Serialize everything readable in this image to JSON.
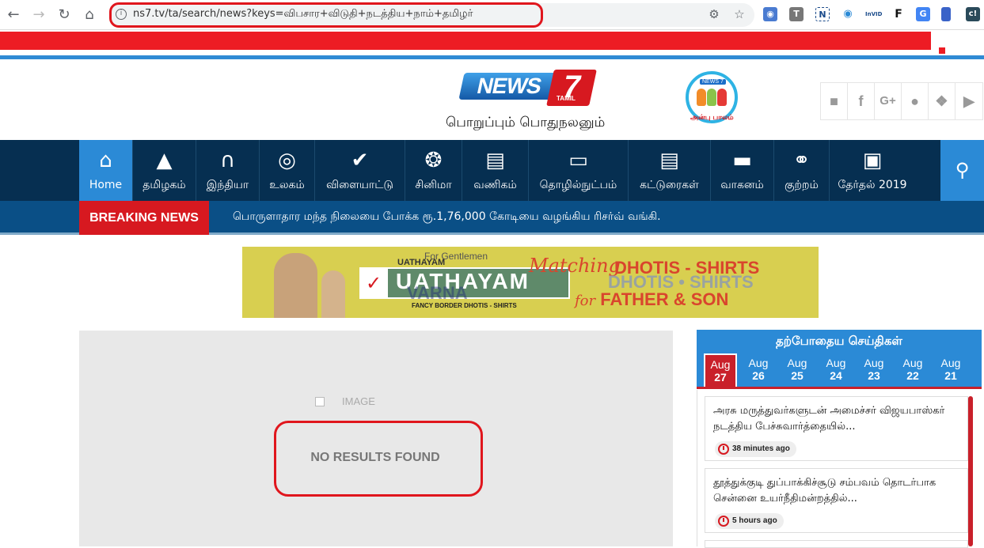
{
  "browser": {
    "url": "ns7.tv/ta/search/news?keys=விபசார+விடுதி+நடத்திய+நாம்+தமிழர்",
    "extensions": [
      "camera-ext",
      "T",
      "N",
      "target-ext",
      "InVID",
      "F",
      "translate-ext",
      "bookmark-ext",
      "c!"
    ]
  },
  "site": {
    "logo_news": "NEWS",
    "logo_seven": "7",
    "logo_tamil": "TAMIL",
    "tagline": "பொறுப்பும் பொதுநலனும்",
    "anbu_badge": "NEWS 7",
    "anbu_text": "அன்பு பாலம்",
    "social": [
      "android-icon",
      "facebook-icon",
      "google-plus-icon",
      "apple-icon",
      "twitter-icon",
      "youtube-icon"
    ]
  },
  "nav": {
    "items": [
      {
        "label": "Home",
        "icon": "home-icon"
      },
      {
        "label": "தமிழகம்",
        "icon": "temple-icon"
      },
      {
        "label": "இந்தியா",
        "icon": "india-gate-icon"
      },
      {
        "label": "உலகம்",
        "icon": "globe-icon"
      },
      {
        "label": "விளையாட்டு",
        "icon": "hockey-icon"
      },
      {
        "label": "சினிமா",
        "icon": "film-reel-icon"
      },
      {
        "label": "வணிகம்",
        "icon": "money-icon"
      },
      {
        "label": "தொழில்நுட்பம்",
        "icon": "laptop-icon"
      },
      {
        "label": "கட்டுரைகள்",
        "icon": "newspaper-icon"
      },
      {
        "label": "வாகனம்",
        "icon": "car-icon"
      },
      {
        "label": "குற்றம்",
        "icon": "handcuffs-icon"
      },
      {
        "label": "தேர்தல் 2019",
        "icon": "ballot-box-icon"
      }
    ]
  },
  "breaking": {
    "label": "BREAKING NEWS",
    "text": "பொருளாதார மந்த நிலையை போக்க ரூ.1,76,000 கோடியை வழங்கிய ரிசர்வ் வங்கி."
  },
  "ad": {
    "for_gentlemen": "For Gentlemen",
    "uathayam_small": "UATHAYAM",
    "uathayam": "UATHAYAM",
    "varna": "VARNA",
    "fancy": "FANCY BORDER DHOTIS - SHIRTS",
    "matching": "Matching",
    "dhotis_shirts_1": "DHOTIS - SHIRTS",
    "dhotis_shirts_2": "DHOTIS • SHIRTS",
    "for": "for",
    "father_son": "FATHER & SON"
  },
  "results": {
    "image_alt": "IMAGE",
    "message": "NO RESULTS FOUND"
  },
  "sidebar": {
    "title": "தற்போதைய செய்திகள்",
    "dates": [
      {
        "month": "Aug",
        "day": "27",
        "active": true
      },
      {
        "month": "Aug",
        "day": "26"
      },
      {
        "month": "Aug",
        "day": "25"
      },
      {
        "month": "Aug",
        "day": "24"
      },
      {
        "month": "Aug",
        "day": "23"
      },
      {
        "month": "Aug",
        "day": "22"
      },
      {
        "month": "Aug",
        "day": "21"
      }
    ],
    "news": [
      {
        "title": "அரசு மருத்துவர்களுடன் அமைச்சர் விஜயபாஸ்கர் நடத்திய பேச்சுவார்த்தையில்...",
        "time": "38 minutes ago"
      },
      {
        "title": "தூத்துக்குடி துப்பாக்கிச்சூடு சம்பவம் தொடர்பாக சென்னை உயர்நீதிமன்றத்தில்...",
        "time": "5 hours ago"
      }
    ]
  },
  "colors": {
    "nav_bg": "#062f51",
    "accent_blue": "#2b8ad6",
    "breaking_red": "#d71920",
    "annotation_red": "#e0161d"
  }
}
